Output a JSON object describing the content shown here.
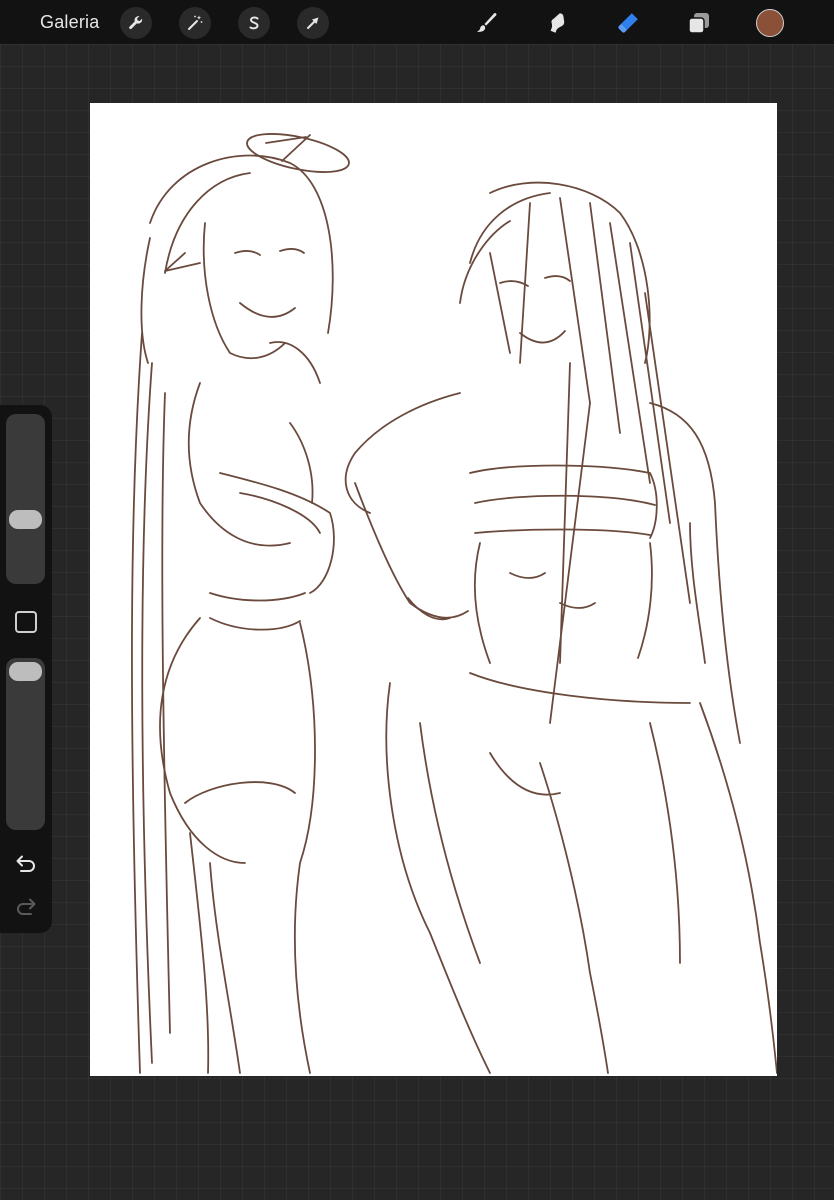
{
  "app": {
    "gallery_label": "Galeria"
  },
  "toolbar": {
    "left_tools": [
      {
        "name": "actions",
        "icon": "wrench-icon"
      },
      {
        "name": "adjustments",
        "icon": "magic-wand-icon"
      },
      {
        "name": "selection",
        "icon": "selection-s-icon"
      },
      {
        "name": "transform",
        "icon": "arrow-icon"
      }
    ],
    "right_tools": [
      {
        "name": "brush",
        "icon": "brush-icon",
        "active": false
      },
      {
        "name": "smudge",
        "icon": "smudge-finger-icon",
        "active": false
      },
      {
        "name": "eraser",
        "icon": "eraser-icon",
        "active": true
      },
      {
        "name": "layers",
        "icon": "layers-icon",
        "active": false
      }
    ],
    "current_color": "#8a5138"
  },
  "sidebar": {
    "brush_size_level": 0.5,
    "opacity_level": 0.06,
    "modify_icon": "square-icon",
    "undo_icon": "undo-arrow-icon",
    "redo_icon": "redo-arrow-icon"
  },
  "colors": {
    "accent_blue": "#2f80ed",
    "sketch_stroke": "#6b4a3e",
    "canvas_bg": "#ffffff",
    "workspace_bg": "#262626"
  }
}
